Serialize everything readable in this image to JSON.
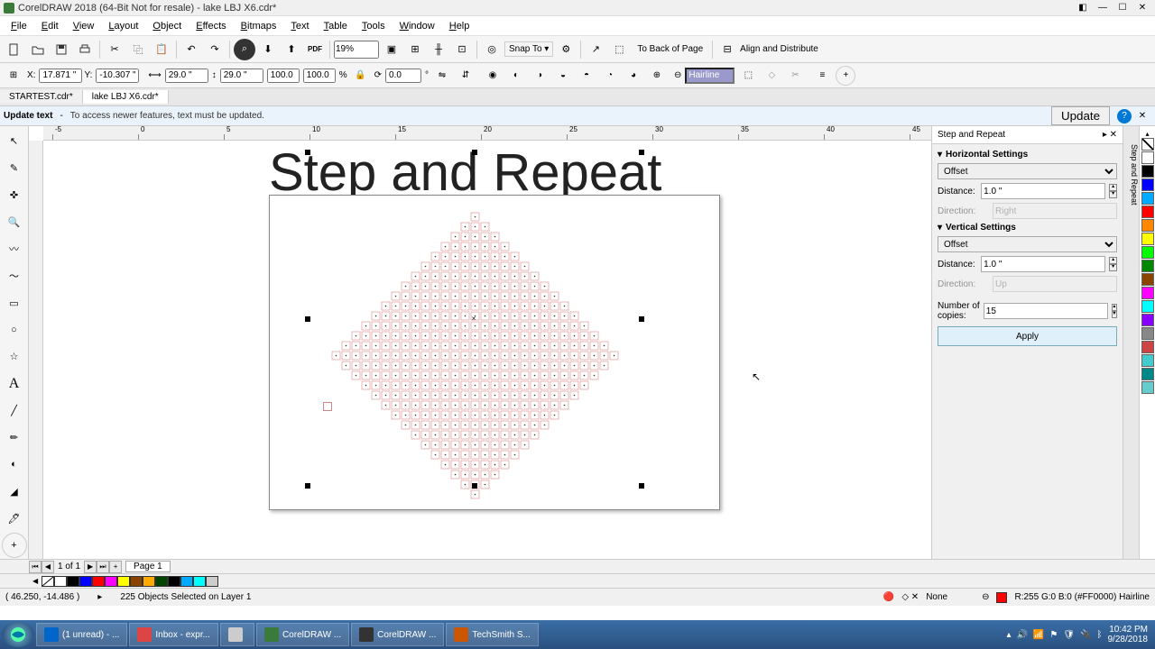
{
  "app": {
    "title": "CorelDRAW 2018 (64-Bit Not for resale) - lake LBJ X6.cdr*"
  },
  "menus": [
    "File",
    "Edit",
    "View",
    "Layout",
    "Object",
    "Effects",
    "Bitmaps",
    "Text",
    "Table",
    "Tools",
    "Window",
    "Help"
  ],
  "std_toolbar": {
    "zoom": "19%",
    "snap": "Snap To",
    "back_of_page": "To Back of Page",
    "align": "Align and Distribute"
  },
  "propbar": {
    "x": "17.871 \"",
    "y": "-10.307 \"",
    "w": "29.0 \"",
    "h": "29.0 \"",
    "sx": "100.0",
    "sy": "100.0",
    "rotate": "0.0",
    "outline": "Hairline"
  },
  "tabs": [
    "STARTEST.cdr*",
    "lake LBJ X6.cdr*"
  ],
  "info_bar": {
    "label": "Update text",
    "text": "To access newer features, text must be updated.",
    "update": "Update"
  },
  "canvas": {
    "big_text": "Step and Repeat",
    "ruler_labels": [
      "-5",
      "0",
      "5",
      "10",
      "15",
      "20",
      "25",
      "30",
      "35",
      "40",
      "45"
    ]
  },
  "docker": {
    "title": "Step and Repeat",
    "h_settings": "Horizontal Settings",
    "v_settings": "Vertical Settings",
    "type_offset": "Offset",
    "distance": "Distance:",
    "direction": "Direction:",
    "h_distance": "1.0 \"",
    "h_direction": "Right",
    "v_distance": "1.0 \"",
    "v_direction": "Up",
    "copies_label": "Number of copies:",
    "copies": "15",
    "apply": "Apply"
  },
  "docker_tab": "Step and Repeat",
  "palette_colors": [
    "#ffffff",
    "#000000",
    "#0000ff",
    "#00aaff",
    "#ff0000",
    "#ff8800",
    "#ffff00",
    "#00ff00",
    "#008800",
    "#884400",
    "#ff00ff",
    "#00ffff",
    "#8800ff",
    "#888888",
    "#cc4444",
    "#44cccc",
    "#008888",
    "#66cccc"
  ],
  "page_nav": {
    "info": "1  of  1",
    "page": "Page 1"
  },
  "color_bar": [
    "#ffffff",
    "#000000",
    "#0000ff",
    "#ff0000",
    "#ff00ff",
    "#ffff00",
    "#884400",
    "#ffaa00",
    "#004400",
    "#000000",
    "#00aaff",
    "#00ffff",
    "#cccccc"
  ],
  "status": {
    "coords": "( 46.250, -14.486 )",
    "selection": "225 Objects Selected on Layer 1",
    "fill_none": "None",
    "color_info": "R:255 G:0 B:0 (#FF0000)  Hairline",
    "outline_color": "#ff0000"
  },
  "taskbar": {
    "tasks": [
      {
        "label": "(1 unread) - ...",
        "color": "#0066cc"
      },
      {
        "label": "Inbox - expr...",
        "color": "#dd4444"
      },
      {
        "label": "",
        "color": "#cccccc"
      },
      {
        "label": "CorelDRAW ...",
        "color": "#3a7a3a"
      },
      {
        "label": "CorelDRAW ...",
        "color": "#333333"
      },
      {
        "label": "TechSmith S...",
        "color": "#cc5500"
      }
    ],
    "time": "10:42 PM",
    "date": "9/28/2018"
  }
}
